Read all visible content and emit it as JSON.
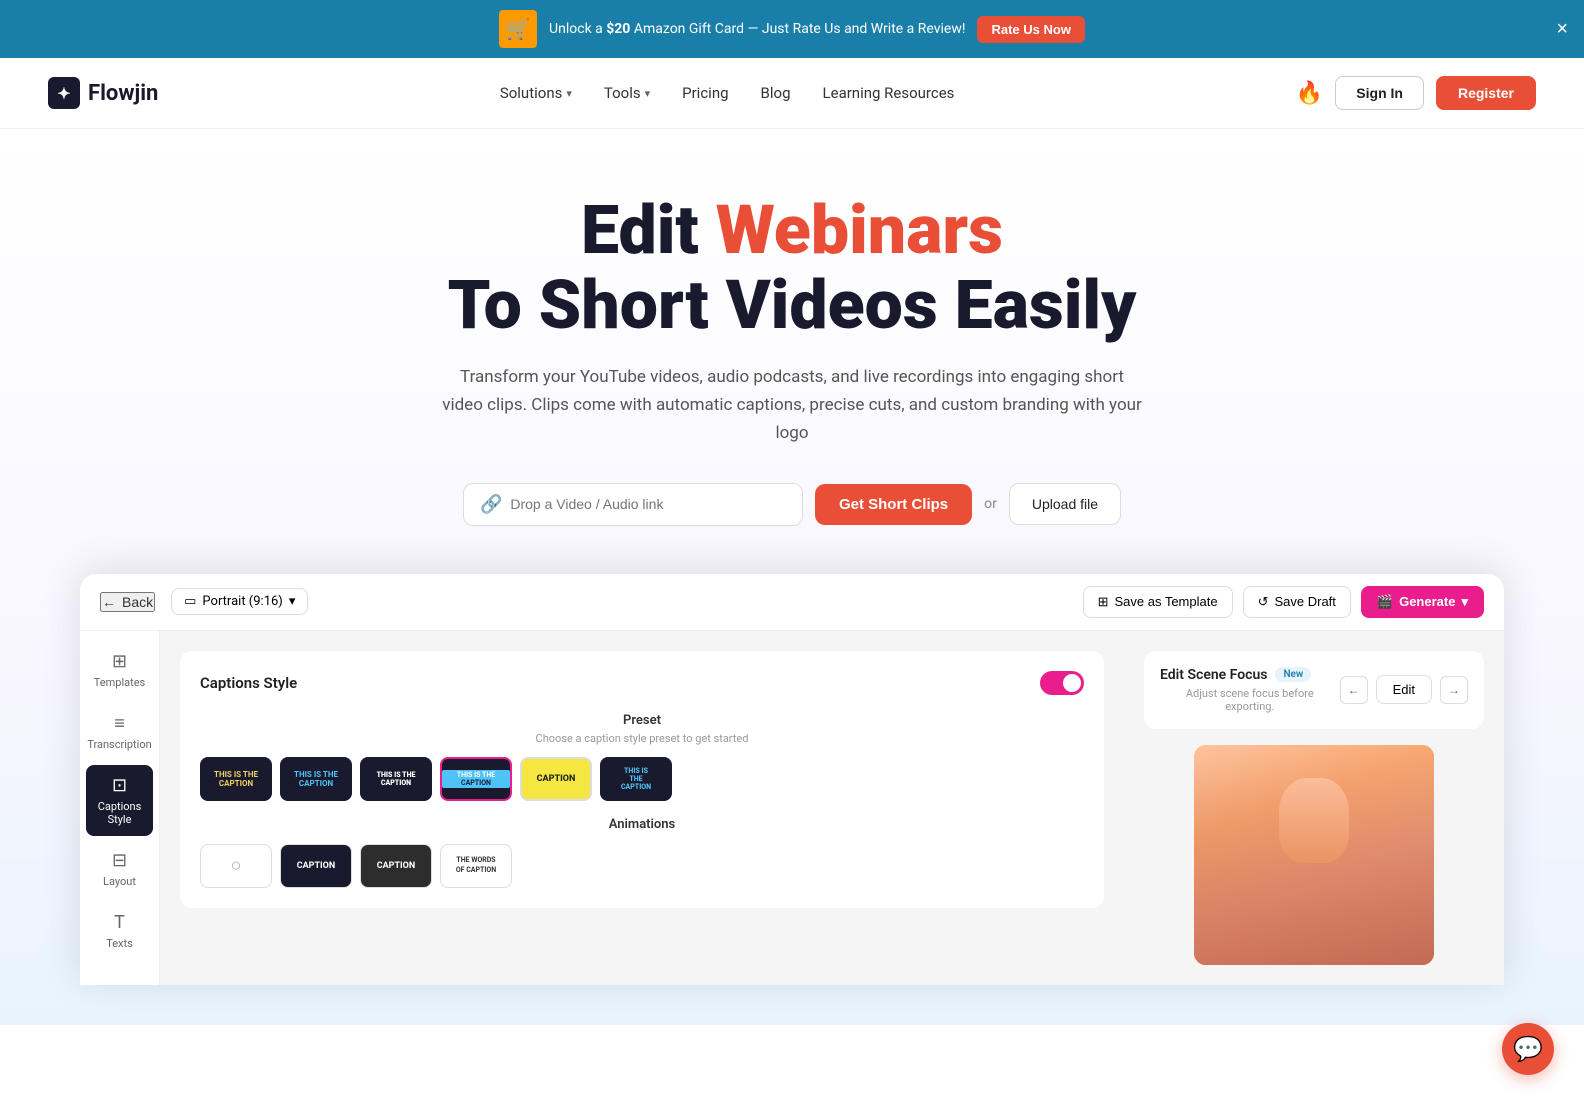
{
  "banner": {
    "amazon_icon": "🛒",
    "text_prefix": "Unlock a ",
    "amount": "$20",
    "text_suffix": " Amazon Gift Card — Just Rate Us and Write a Review!",
    "cta_label": "Rate Us Now",
    "close_icon": "×"
  },
  "navbar": {
    "logo_text": "Flowjin",
    "logo_icon": "✦",
    "nav_items": [
      {
        "label": "Solutions",
        "has_dropdown": true
      },
      {
        "label": "Tools",
        "has_dropdown": true
      },
      {
        "label": "Pricing",
        "has_dropdown": false
      },
      {
        "label": "Blog",
        "has_dropdown": false
      },
      {
        "label": "Learning Resources",
        "has_dropdown": false
      }
    ],
    "fire_icon": "🔥",
    "signin_label": "Sign In",
    "register_label": "Register"
  },
  "hero": {
    "title_prefix": "Edit ",
    "title_accent": "Webinars",
    "title_suffix": "To Short Videos Easily",
    "subtitle": "Transform your YouTube videos, audio podcasts, and live recordings into engaging short video clips. Clips come with automatic captions, precise cuts, and custom branding with your logo",
    "input_placeholder": "Drop a Video / Audio link",
    "link_icon": "🔗",
    "cta_label": "Get Short Clips",
    "or_text": "or",
    "upload_label": "Upload file"
  },
  "editor": {
    "back_label": "Back",
    "portrait_label": "Portrait (9:16)",
    "save_template_label": "Save as Template",
    "save_draft_label": "Save Draft",
    "generate_label": "Generate",
    "sidebar_items": [
      {
        "label": "Templates",
        "icon": "⊞",
        "active": false
      },
      {
        "label": "Transcription",
        "icon": "≡",
        "active": false
      },
      {
        "label": "Captions Style",
        "icon": "⊡",
        "active": true
      },
      {
        "label": "Layout",
        "icon": "⊟",
        "active": false
      },
      {
        "label": "Texts",
        "icon": "T",
        "active": false
      }
    ],
    "panel_title": "Captions Style",
    "preset_section": "Preset",
    "preset_desc": "Choose a caption style preset to get started",
    "presets": [
      {
        "id": 1,
        "style": "yellow-highlight"
      },
      {
        "id": 2,
        "style": "blue-highlight"
      },
      {
        "id": 3,
        "style": "bold-white"
      },
      {
        "id": 4,
        "style": "blue-box",
        "selected": true
      },
      {
        "id": 5,
        "style": "yellow-bg"
      },
      {
        "id": 6,
        "style": "blue-text"
      }
    ],
    "animations_label": "Animations",
    "animations": [
      {
        "id": 1,
        "label": "○",
        "style": "none"
      },
      {
        "id": 2,
        "label": "Caption",
        "style": "dark"
      },
      {
        "id": 3,
        "label": "Caption",
        "style": "dark2"
      },
      {
        "id": 4,
        "label": "The Words of Caption",
        "style": "words"
      }
    ],
    "scene_focus_title": "Edit Scene Focus",
    "scene_focus_badge": "New",
    "scene_focus_desc": "Adjust scene focus before exporting.",
    "edit_btn": "Edit"
  },
  "chat": {
    "icon": "💬"
  }
}
